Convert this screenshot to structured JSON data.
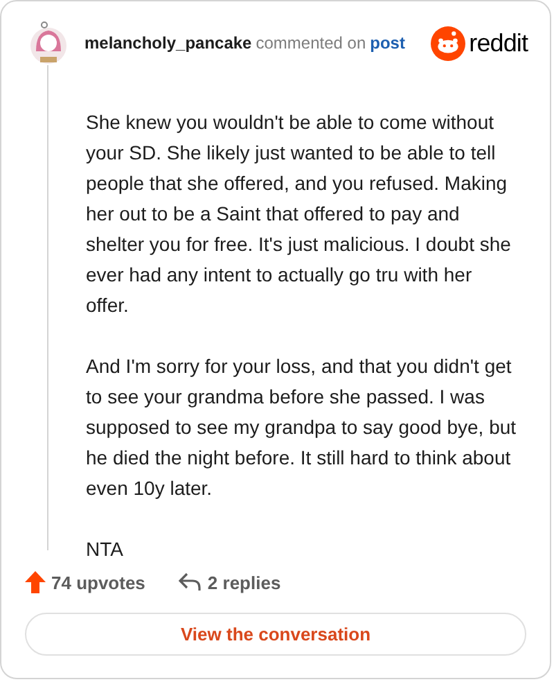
{
  "author": "melancholy_pancake",
  "action": "commented on",
  "link": "post",
  "brand": "reddit",
  "paragraphs": [
    "She knew you wouldn't be able to come without your SD. She likely just wanted to be able to tell people that she offered, and you refused. Making her out to be a Saint that offered to pay and shelter you for free. It's just malicious. I doubt she ever had any intent to actually go tru with her offer.",
    "And I'm sorry for your loss, and that you didn't get to see your grandma before she passed. I was supposed to see my grandpa to say good bye, but he died the night before. It still hard to think about even 10y later.",
    "NTA"
  ],
  "upvotes": "74 upvotes",
  "replies": "2 replies",
  "button": "View the conversation"
}
